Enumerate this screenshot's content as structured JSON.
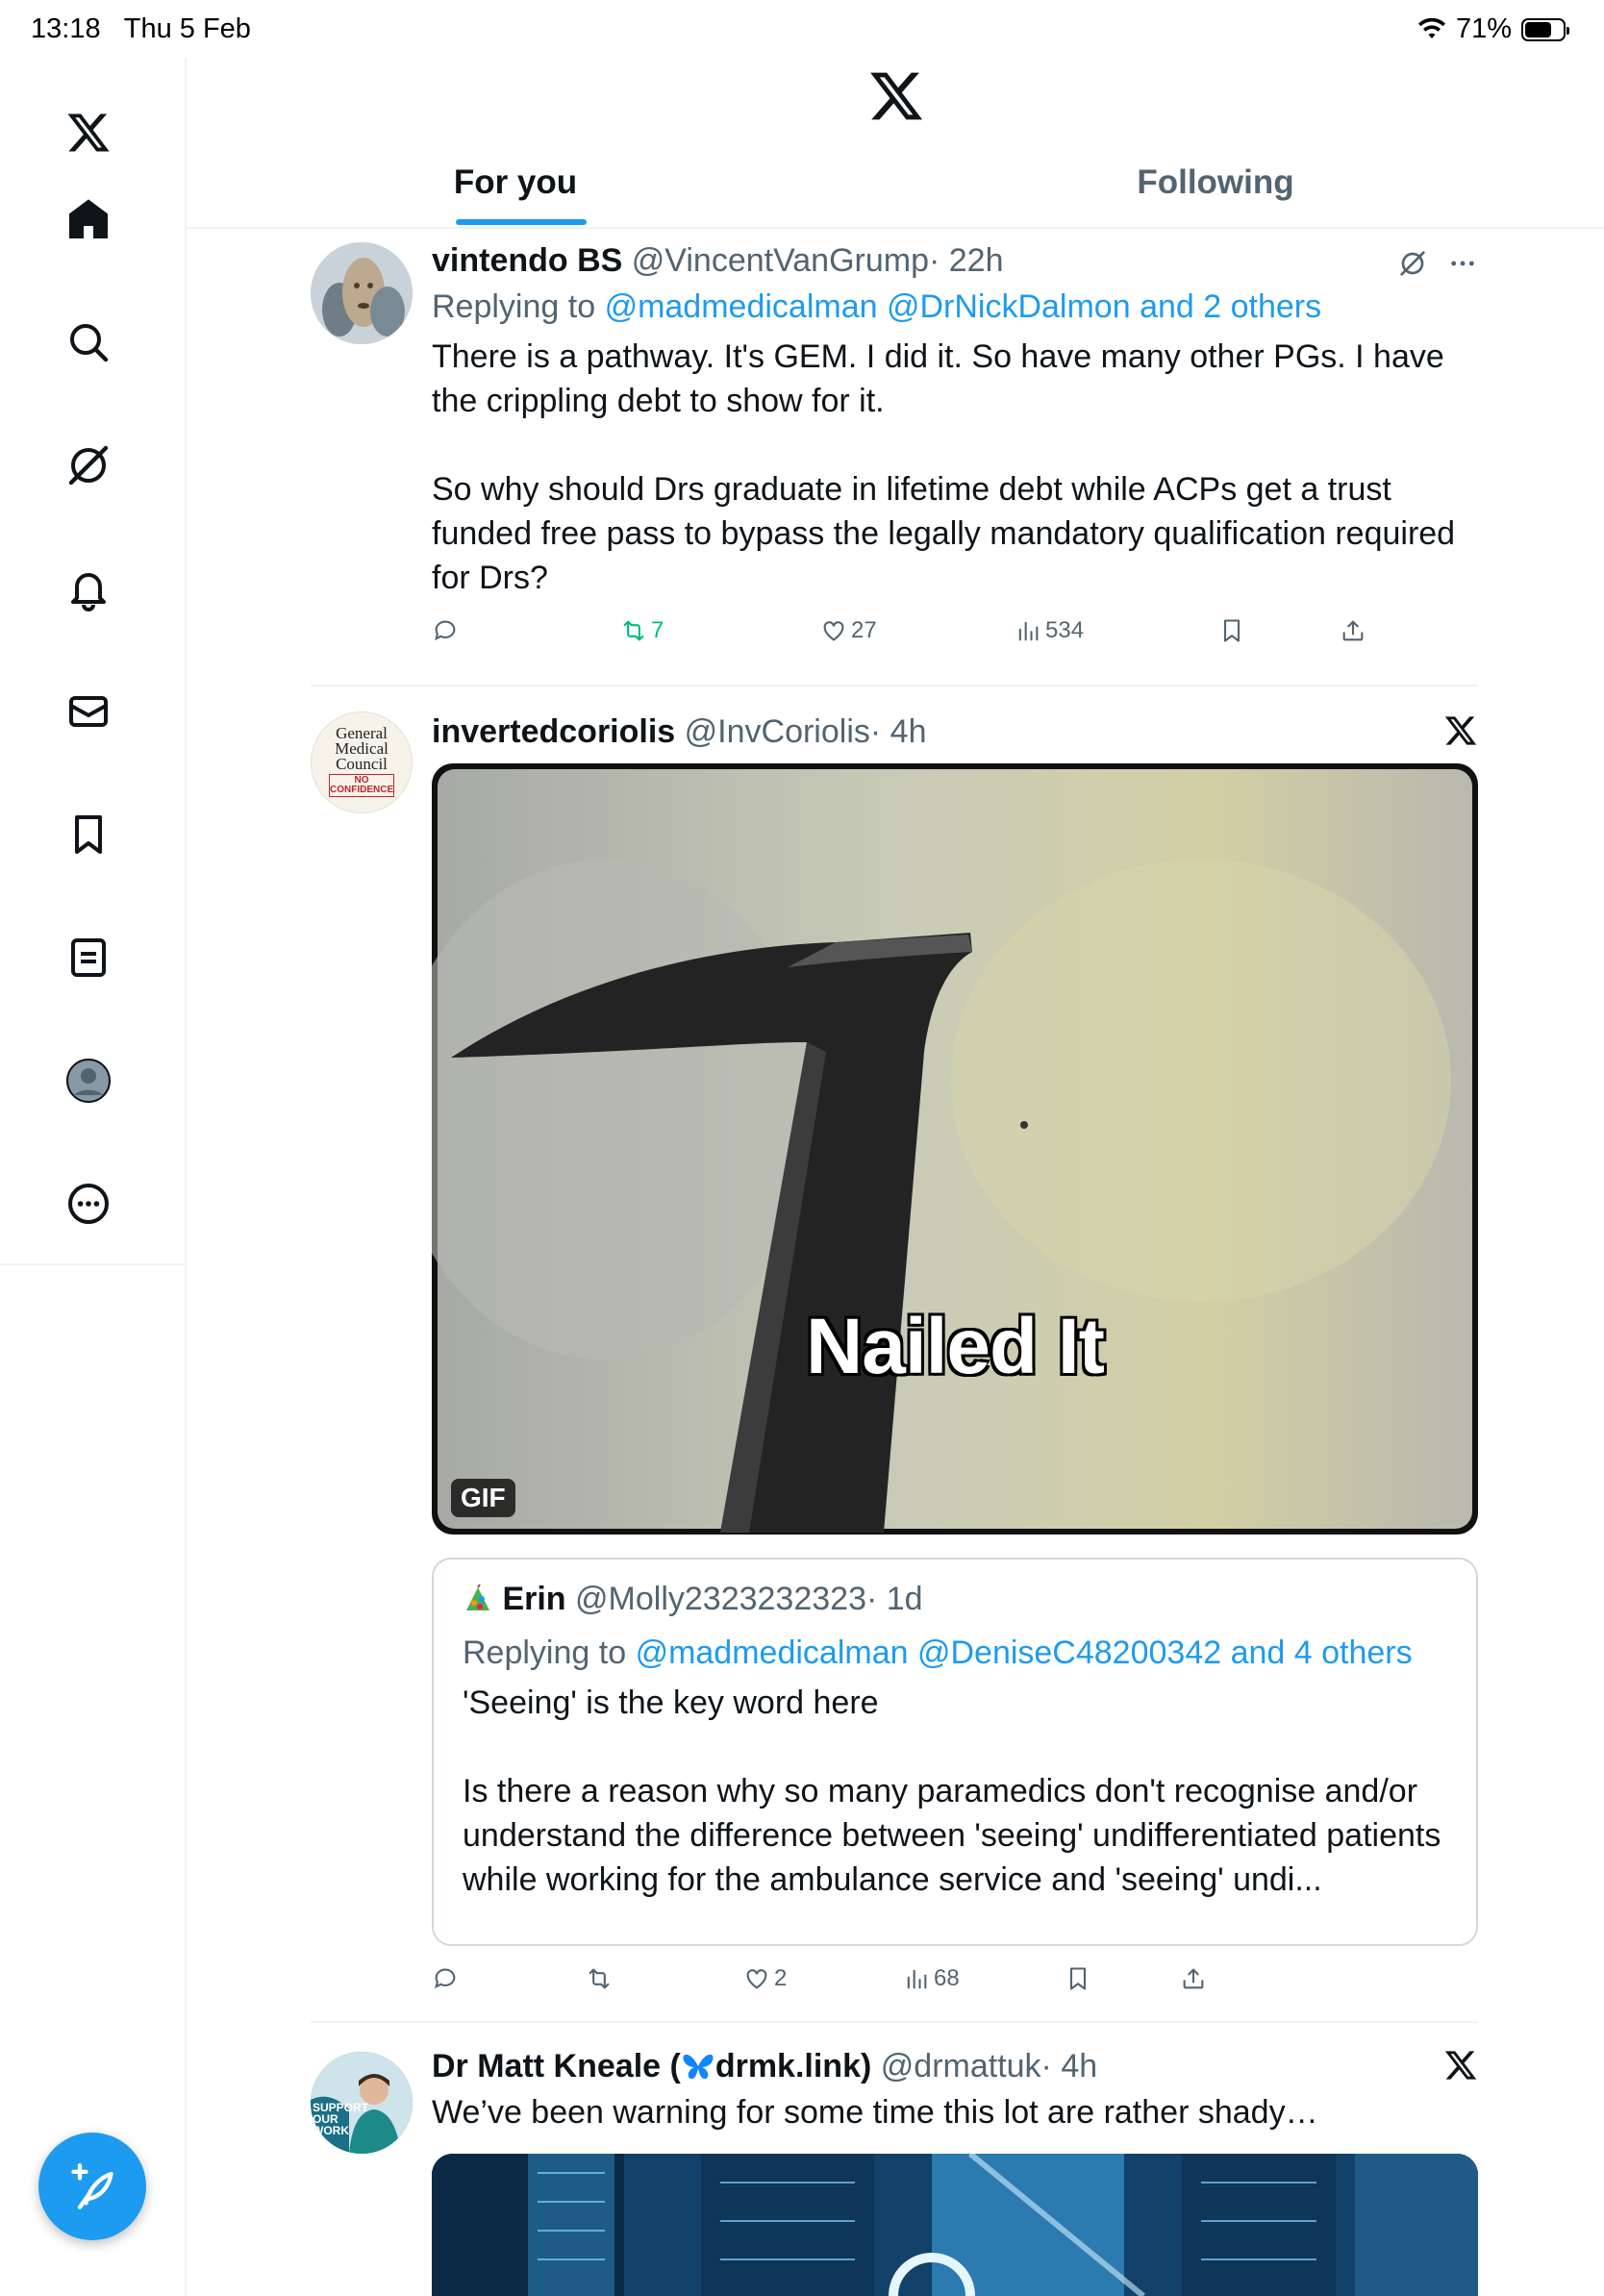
{
  "status_bar": {
    "time": "13:18",
    "date": "Thu 5 Feb",
    "battery": "71%",
    "battery_level": 0.71
  },
  "header": {
    "tabs": [
      {
        "label": "For you",
        "active": true
      },
      {
        "label": "Following",
        "active": false
      }
    ]
  },
  "sidebar": {
    "items": [
      "x-logo",
      "home-icon",
      "search-icon",
      "grok-icon",
      "notifications-icon",
      "messages-icon",
      "bookmarks-icon",
      "lists-icon",
      "profile-icon",
      "more-icon"
    ]
  },
  "tweets": [
    {
      "name": "vintendo BS",
      "handle": "@VincentVanGrump",
      "time": "· 22h",
      "replying_prefix": "Replying to",
      "replying_to": "@madmedicalman @DrNickDalmon and 2 others",
      "text": "There is a pathway. It's GEM. I did it. So have many other PGs. I have the crippling debt to show for it.\n\nSo why should Drs graduate in lifetime debt while ACPs get a trust funded free pass to bypass the legally mandatory qualification required for Drs?",
      "stats": {
        "replies": "",
        "reposts": "7",
        "likes": "27",
        "views": "534"
      }
    },
    {
      "name": "invertedcoriolis",
      "handle": "@InvCoriolis",
      "time": "· 4h",
      "avatar_text": {
        "line1": "General",
        "line2": "Medical",
        "line3": "Council",
        "stamp": "NO CONFIDENCE"
      },
      "media": {
        "caption": "Nailed It",
        "badge": "GIF"
      },
      "quote": {
        "name": "Erin",
        "handle": "@Molly2323232323",
        "time": "· 1d",
        "replying_prefix": "Replying to",
        "replying_to": "@madmedicalman @DeniseC48200342 and 4 others",
        "text": "'Seeing' is the key word here\n\nIs there a reason why so many paramedics don't recognise and/or understand the difference between 'seeing' undifferentiated patients while working for the ambulance service and 'seeing' undi..."
      },
      "stats": {
        "replies": "",
        "reposts": "",
        "likes": "2",
        "views": "68"
      }
    },
    {
      "name_prefix": "Dr Matt Kneale (",
      "name_suffix": "drmk.link)",
      "handle": "@drmattuk",
      "time": "· 4h",
      "text": "We’ve been warning for some time this lot are rather shady…",
      "avatar_text": "SUPPORT OUR WORK"
    }
  ]
}
